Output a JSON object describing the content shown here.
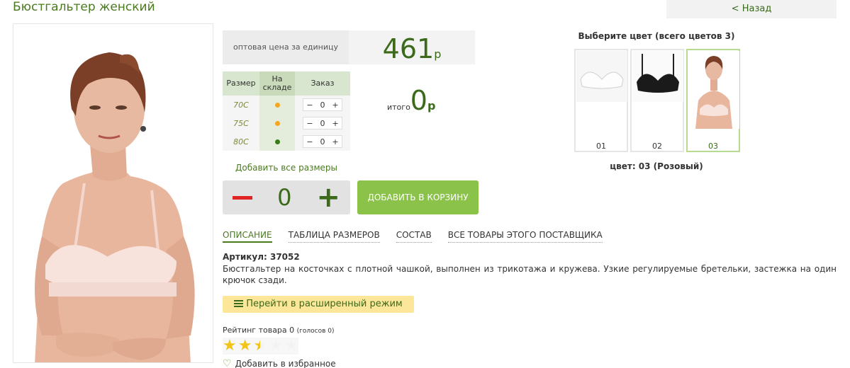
{
  "page": {
    "title": "Бюстгальтер женский",
    "back_label": "< Назад"
  },
  "price": {
    "label": "оптовая цена за единицу",
    "value": "461",
    "currency": "р"
  },
  "sizes_table": {
    "headers": [
      "Размер",
      "На складе",
      "Заказ"
    ],
    "rows": [
      {
        "size": "70C",
        "stock_color": "#f5a623",
        "qty": "0"
      },
      {
        "size": "75C",
        "stock_color": "#f5a623",
        "qty": "0"
      },
      {
        "size": "80C",
        "stock_color": "#3a7a1a",
        "qty": "0"
      }
    ],
    "minus": "−",
    "plus": "+"
  },
  "total": {
    "label": "итого",
    "value": "0",
    "currency": "р"
  },
  "add_all_label": "Добавить все размеры",
  "quantity": {
    "value": "0",
    "plus": "+"
  },
  "cart_button": "ДОБАВИТЬ В КОРЗИНУ",
  "colors": {
    "title": "Выберите цвет (всего цветов 3)",
    "swatches": [
      {
        "label": "01",
        "color": "#f4f4f4"
      },
      {
        "label": "02",
        "color": "#1a1a1a"
      },
      {
        "label": "03",
        "color": "#f5ddd5"
      }
    ],
    "selected_text": "цвет: 03 (Розовый)"
  },
  "tabs": [
    "ОПИСАНИЕ",
    "ТАБЛИЦА РАЗМЕРОВ",
    "СОСТАВ",
    "ВСЕ ТОВАРЫ ЭТОГО ПОСТАВЩИКА"
  ],
  "article": "Артикул: 37052",
  "description": "Бюстгальтер на косточках с плотной чашкой, выполнен из трикотажа и кружева. Узкие регулируемые бретельки, застежка на один крючок сзади.",
  "advanced_mode_label": "Перейти в расширенный режим",
  "rating": {
    "label": "Рейтинг товара 0",
    "votes": "(голосов 0)",
    "stars_filled": 2.5,
    "stars_total": 5
  },
  "favorite_label": "Добавить в избранное",
  "colors_accent": {
    "green": "#4a7a1f",
    "button": "#8bc34a",
    "minus": "#e02424"
  }
}
